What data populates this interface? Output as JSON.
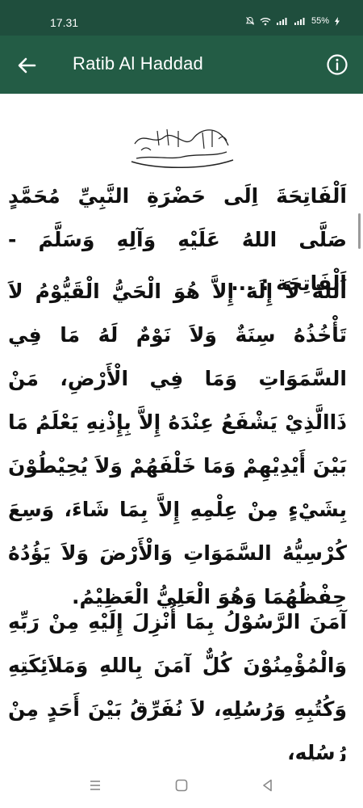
{
  "status_bar": {
    "time": "17.31",
    "battery": "55%"
  },
  "app_bar": {
    "title": "Ratib Al Haddad",
    "back_icon": "arrow-left-icon",
    "info_icon": "info-circle-icon",
    "background": "#235c45"
  },
  "content": {
    "bismillah_icon": "bismillah-calligraphy-icon",
    "paragraphs": [
      "اَلْفَاتِحَةَ اِلَى حَضْرَةِ النَّبِيِّ مُحَمَّدٍ صَلَّى اللهُ عَلَيْهِ وَآلِهِ وَسَلَّمَ - اَلْفَاتِحَة : ...",
      "اَللهُ لاَ إِلَهَ إِلاَّ هُوَ الْحَيُّ الْقَيُّوْمُ لاَ تَأْخُذُهُ سِنَةٌ وَلاَ نَوْمٌ لَهُ مَا فِي السَّمَوَاتِ وَمَا فِي الْأَرْضِ، مَنْ ذَاالَّذِيْ يَشْفَعُ عِنْدَهُ إِلاَّ بِإِذْنِهِ يَعْلَمُ مَا بَيْنَ أَيْدِيْهِمْ وَمَا خَلْفَهُمْ وَلاَ يُحِيْطُوْنَ بِشَيْءٍ مِنْ عِلْمِهِ إِلاَّ بِمَا شَاءَ، وَسِعَ كُرْسِيُّهُ السَّمَوَاتِ وَالْأَرْضَ وَلاَ يَؤُدُهُ حِفْظُهُمَا وَهُوَ الْعَلِيُّ الْعَظِيْمُ.",
      "آمَنَ الرَّسُوْلُ بِمَا أُنْزِلَ إِلَيْهِ مِنْ رَبِّهِ وَالْمُؤْمِنُوْنَ كُلٌّ آمَنَ بِاللهِ وَمَلاَئِكَتِهِ وَكُتُبِهِ وَرُسُلِهِ، لاَ نُفَرِّقُ بَيْنَ أَحَدٍ مِنْ رُسُلِهِ،"
    ]
  },
  "nav_bar": {
    "recents_icon": "recents-lines-icon",
    "home_icon": "home-square-icon",
    "back_icon": "back-triangle-icon"
  }
}
